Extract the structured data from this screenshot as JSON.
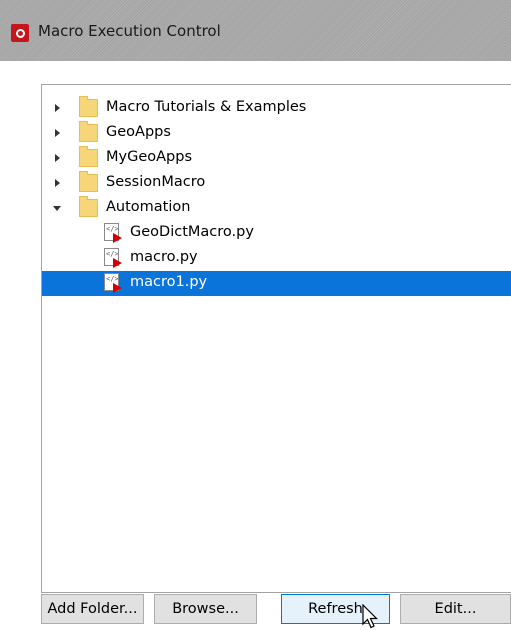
{
  "window": {
    "title": "Macro Execution Control",
    "app_icon": "app-logo-icon"
  },
  "tree": {
    "folders": [
      {
        "label": "Macro Tutorials & Examples",
        "expanded": false
      },
      {
        "label": "GeoApps",
        "expanded": false
      },
      {
        "label": "MyGeoApps",
        "expanded": false
      },
      {
        "label": "SessionMacro",
        "expanded": false
      },
      {
        "label": "Automation",
        "expanded": true
      }
    ],
    "files": [
      {
        "label": "GeoDictMacro.py",
        "selected": false
      },
      {
        "label": "macro.py",
        "selected": false
      },
      {
        "label": "macro1.py",
        "selected": true
      }
    ]
  },
  "buttons": {
    "add_folder": "Add Folder...",
    "browse": "Browse...",
    "refresh": "Refresh",
    "edit": "Edit..."
  },
  "colors": {
    "selection": "#0a74da",
    "folder": "#f7d67a",
    "titlebar": "#ababab"
  }
}
